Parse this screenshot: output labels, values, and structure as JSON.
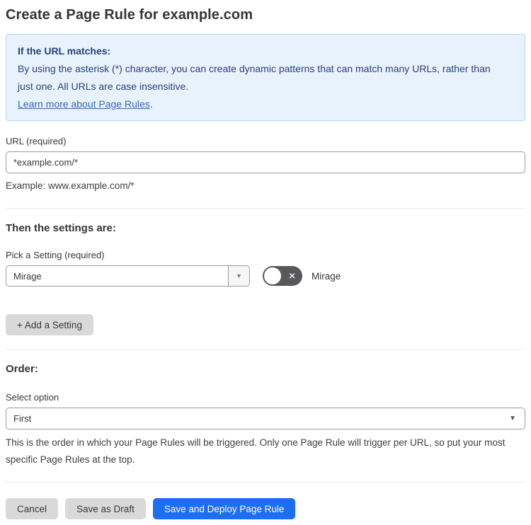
{
  "page": {
    "title": "Create a Page Rule for example.com"
  },
  "info_box": {
    "heading": "If the URL matches:",
    "body": "By using the asterisk (*) character, you can create dynamic patterns that can match many URLs, rather than just one. All URLs are case insensitive.",
    "link_label": "Learn more about Page Rules",
    "link_suffix": "."
  },
  "url_field": {
    "label": "URL (required)",
    "value": "*example.com/*",
    "helper": "Example: www.example.com/*"
  },
  "settings_section": {
    "heading": "Then the settings are:",
    "picker_label": "Pick a Setting (required)",
    "picker_value": "Mirage",
    "toggle_label": "Mirage",
    "toggle_state": "off",
    "add_setting_label": "+ Add a Setting"
  },
  "order_section": {
    "heading": "Order:",
    "select_label": "Select option",
    "select_value": "First",
    "helper": "This is the order in which your Page Rules will be triggered. Only one Page Rule will trigger per URL, so put your most specific Page Rules at the top."
  },
  "footer": {
    "cancel_label": "Cancel",
    "save_draft_label": "Save as Draft",
    "save_deploy_label": "Save and Deploy Page Rule"
  },
  "icons": {
    "chevron_down": "▼",
    "toggle_x": "✕"
  },
  "colors": {
    "primary_button": "#1d6ef2",
    "gray_button": "#d9d9d9",
    "info_background": "#e8f2fc",
    "info_border": "#b3d3f1",
    "info_text": "#27437a",
    "link": "#3568b5",
    "toggle_off": "#58585c",
    "input_border": "#9b9b9b"
  }
}
